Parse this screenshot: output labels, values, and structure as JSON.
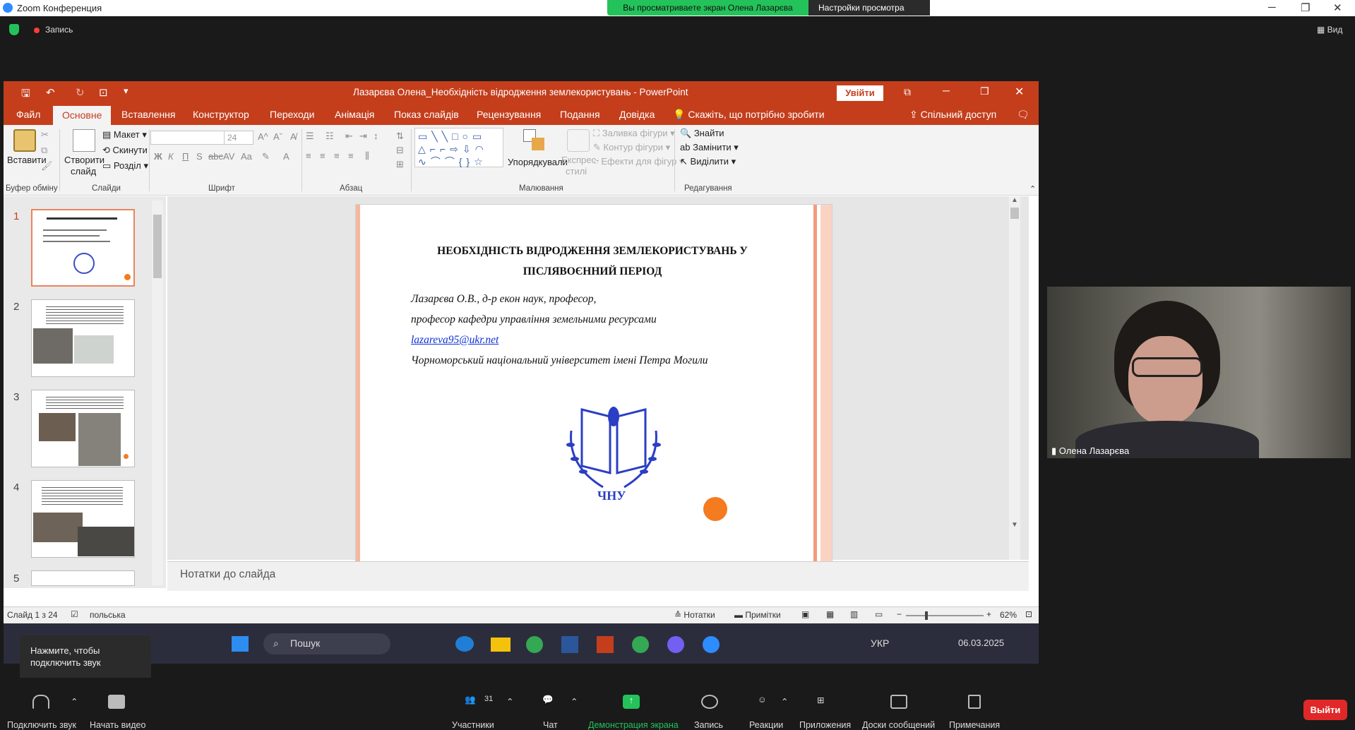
{
  "zoom": {
    "window_title": "Zoom Конференция",
    "share_banner": "Вы просматриваете экран Олена Лазарєва",
    "view_settings": "Настройки просмотра",
    "record_label": "Запись",
    "view_label": "Вид"
  },
  "ppt": {
    "title": "Лазарєва Олена_Необхідність відродження землекористувань  -  PowerPoint",
    "login": "Увійти",
    "tabs": [
      "Файл",
      "Основне",
      "Вставлення",
      "Конструктор",
      "Переходи",
      "Анімація",
      "Показ слайдів",
      "Рецензування",
      "Подання",
      "Довідка"
    ],
    "tell_me": "Скажіть, що потрібно зробити",
    "share": "Спільний доступ",
    "ribbon": {
      "paste": "Вставити",
      "new_slide_1": "Створити",
      "new_slide_2": "слайд",
      "layout": "Макет",
      "reset": "Скинути",
      "section": "Розділ",
      "font_size": "24",
      "arrange": "Упорядкували",
      "quick_styles_1": "Експрес-",
      "quick_styles_2": "стилі",
      "shape_fill": "Заливка фігури",
      "shape_outline": "Контур фігури",
      "shape_effects": "Ефекти для фігур",
      "find": "Знайти",
      "replace": "Замінити",
      "select": "Виділити",
      "groups": [
        "Буфер обміну",
        "Слайди",
        "Шрифт",
        "Абзац",
        "Малювання",
        "Редагування"
      ]
    },
    "thumb_numbers": [
      "1",
      "2",
      "3",
      "4",
      "5"
    ],
    "slide": {
      "title_line1": "НЕОБХІДНІСТЬ ВІДРОДЖЕННЯ ЗЕМЛЕКОРИСТУВАНЬ У",
      "title_line2": "ПІСЛЯВОЄННИЙ ПЕРІОД",
      "author": "Лазарєва О.В., д-р екон наук, професор,",
      "position": "професор кафедри управління земельними ресурсами",
      "email": "lazareva95@ukr.net",
      "university": "Чорноморський національний університет імені Петра Могили",
      "logo_text": "ЧНУ"
    },
    "notes_placeholder": "Нотатки до слайда",
    "status": {
      "slide_count": "Слайд 1 з 24",
      "language": "польська",
      "notes": "Нотатки",
      "comments": "Примітки",
      "zoom": "62%"
    }
  },
  "taskbar": {
    "search": "Пошук",
    "lang": "УКР",
    "date": "06.03.2025"
  },
  "tooltip": {
    "line1": "Нажмите, чтобы",
    "line2": "подключить звук"
  },
  "video": {
    "participant_name": "Олена Лазарєва"
  },
  "toolbar": {
    "audio": "Подключить звук",
    "video": "Начать видео",
    "participants": "Участники",
    "participants_count": "31",
    "chat": "Чат",
    "share": "Демонстрация экрана",
    "record": "Запись",
    "reactions": "Реакции",
    "apps": "Приложения",
    "whiteboards": "Доски сообщений",
    "notes": "Примечания",
    "leave": "Выйти"
  },
  "colors": {
    "ppt_accent": "#c43e1c",
    "zoom_green": "#24c25a",
    "leave_red": "#e02828"
  }
}
